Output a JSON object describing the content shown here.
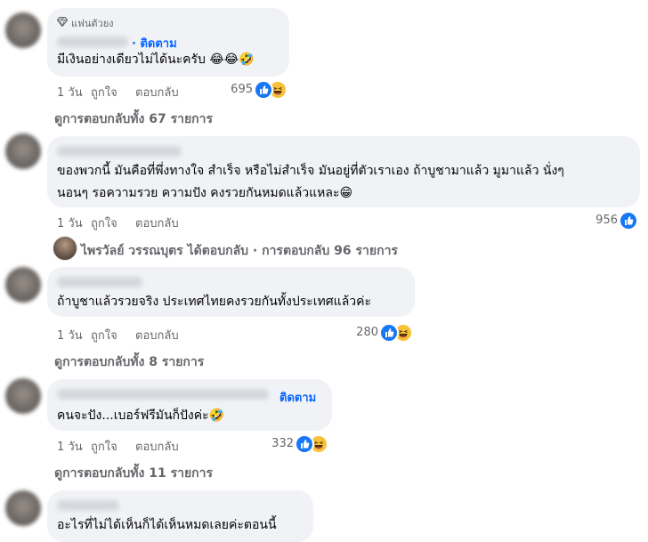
{
  "comments": [
    {
      "badge": "แฟนตัวยง",
      "follow": "· ติดตาม",
      "text": "มีเงินอย่างเดียวไม่ได้นะครับ 😂😂🤣",
      "time": "1 วัน",
      "like": "ถูกใจ",
      "reply": "ตอบกลับ",
      "count": "695",
      "reactions": [
        "like-icon",
        "haha-icon"
      ],
      "replies": "ดูการตอบกลับทั้ง 67 รายการ"
    },
    {
      "text_line1": "ของพวกนี้ มันคือที่พึ่งทางใจ สำเร็จ หรือไม่สำเร็จ มันอยู่ที่ตัวเราเอง ถ้าบูชามาแล้ว มูมาแล้ว นั่งๆ",
      "text_line2": "นอนๆ รอความรวย ความปัง คงรวยกันหมดแล้วแหละ😁",
      "time": "1 วัน",
      "like": "ถูกใจ",
      "reply": "ตอบกลับ",
      "count": "956",
      "reactions": [
        "like-icon"
      ],
      "replier": "ไพรวัลย์ วรรณบุตร ได้ตอบกลับ · การตอบกลับ 96 รายการ"
    },
    {
      "text": "ถ้าบูชาแล้วรวยจริง ประเทศไทยคงรวยกันทั้งประเทศแล้วค่ะ",
      "time": "1 วัน",
      "like": "ถูกใจ",
      "reply": "ตอบกลับ",
      "count": "280",
      "reactions": [
        "like-icon",
        "haha-icon"
      ],
      "replies": "ดูการตอบกลับทั้ง 8 รายการ"
    },
    {
      "follow": "ติดตาม",
      "text": "คนจะปัง...เบอร์ฟรีมันก็ปังค่ะ🤣",
      "time": "1 วัน",
      "like": "ถูกใจ",
      "reply": "ตอบกลับ",
      "count": "332",
      "reactions": [
        "like-icon",
        "haha-icon"
      ],
      "replies": "ดูการตอบกลับทั้ง 11 รายการ"
    },
    {
      "text": "อะไรที่ไม่ได้เห็นก็ได้เห็นหมดเลยค่ะตอนนี้"
    }
  ],
  "colors": {
    "accent": "#0866ff",
    "bubble": "#f0f2f5",
    "muted": "#65676b",
    "like": "#1877f2",
    "haha": "#f7c13a"
  }
}
